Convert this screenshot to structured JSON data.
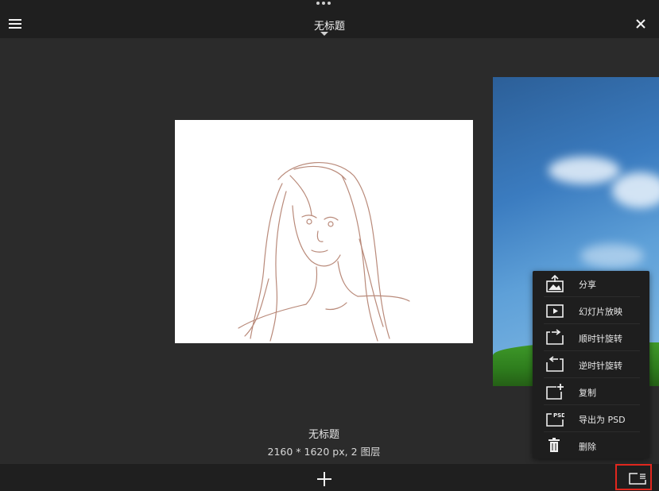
{
  "header": {
    "title": "无标题",
    "more_icon": "ellipsis-icon",
    "menu_icon": "hamburger-icon",
    "close_icon": "close-icon"
  },
  "gallery": {
    "current": {
      "name": "无标题",
      "info": "2160 * 1620 px, 2 图层"
    }
  },
  "context_menu": {
    "items": [
      {
        "label": "分享",
        "icon": "share-icon"
      },
      {
        "label": "幻灯片放映",
        "icon": "slideshow-icon"
      },
      {
        "label": "顺时针旋转",
        "icon": "rotate-clockwise-icon"
      },
      {
        "label": "逆时针旋转",
        "icon": "rotate-counterclockwise-icon"
      },
      {
        "label": "复制",
        "icon": "duplicate-icon"
      },
      {
        "label": "导出为 PSD",
        "icon": "export-psd-icon",
        "badge": "PSD"
      },
      {
        "label": "删除",
        "icon": "trash-icon"
      }
    ]
  },
  "bottombar": {
    "add_icon": "plus-icon",
    "menu_toggle_icon": "gallery-menu-icon",
    "highlight_color": "#e0271e"
  }
}
